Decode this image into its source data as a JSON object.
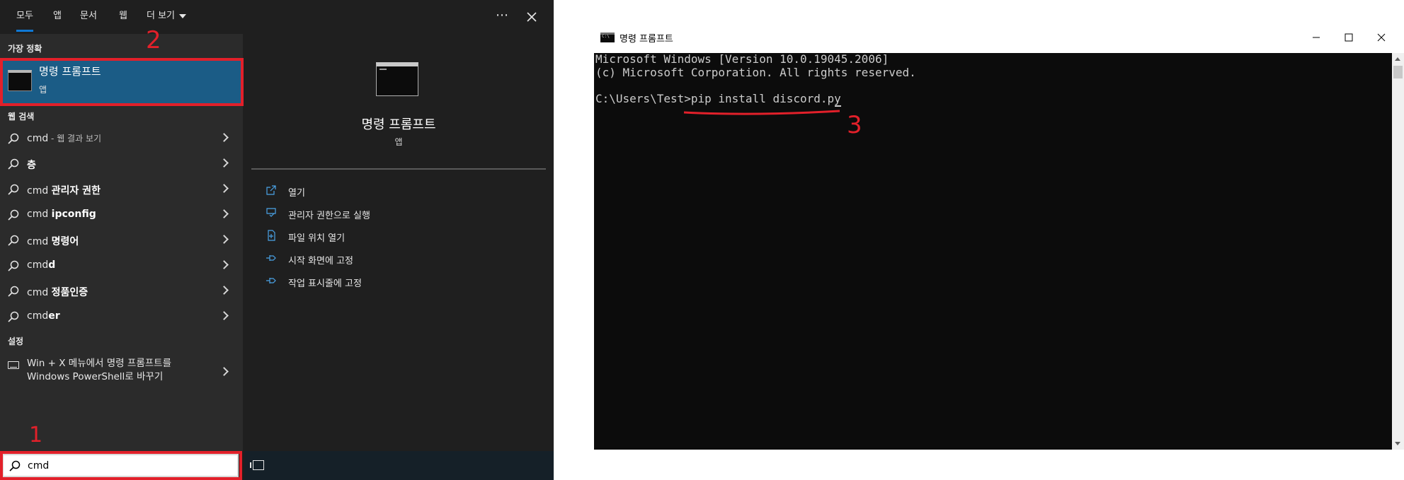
{
  "search_panel": {
    "tabs": [
      {
        "label": "모두",
        "active": true
      },
      {
        "label": "앱",
        "active": false
      },
      {
        "label": "문서",
        "active": false
      },
      {
        "label": "웹",
        "active": false
      },
      {
        "label": "더 보기",
        "active": false
      }
    ],
    "more_icon": "ellipsis-icon",
    "close_icon": "close-icon",
    "best_match": {
      "heading": "가장 정확",
      "name": "명령 프롬프트",
      "type": "앱"
    },
    "web_search": {
      "heading": "웹 검색",
      "items": [
        {
          "prefix": "cmd",
          "bold": "",
          "muted": " - 웹 결과 보기"
        },
        {
          "prefix": "",
          "bold": "층",
          "muted": ""
        },
        {
          "prefix": "cmd ",
          "bold": "관리자 권한",
          "muted": ""
        },
        {
          "prefix": "cmd ",
          "bold": "ipconfig",
          "muted": ""
        },
        {
          "prefix": "cmd ",
          "bold": "명령어",
          "muted": ""
        },
        {
          "prefix": "cmd",
          "bold": "d",
          "muted": ""
        },
        {
          "prefix": "cmd ",
          "bold": "정품인증",
          "muted": ""
        },
        {
          "prefix": "cmd",
          "bold": "er",
          "muted": ""
        }
      ]
    },
    "settings": {
      "heading": "설정",
      "line1": "Win + X 메뉴에서 명령 프롬프트를",
      "line2": "Windows PowerShell로 바꾸기"
    },
    "preview": {
      "title": "명령 프롬프트",
      "subtitle": "앱",
      "actions": [
        {
          "label": "열기",
          "icon": "open-icon"
        },
        {
          "label": "관리자 권한으로 실행",
          "icon": "shield-icon"
        },
        {
          "label": "파일 위치 열기",
          "icon": "file-location-icon"
        },
        {
          "label": "시작 화면에 고정",
          "icon": "pin-icon"
        },
        {
          "label": "작업 표시줄에 고정",
          "icon": "pin-icon"
        }
      ]
    },
    "search_box": {
      "value": "cmd"
    }
  },
  "annotations": {
    "step1": "1",
    "step2": "2",
    "step3": "3",
    "color": "#e2202a"
  },
  "cmd_window": {
    "title": "명령 프롬프트",
    "console_lines": [
      "Microsoft Windows [Version 10.0.19045.2006]",
      "(c) Microsoft Corporation. All rights reserved.",
      "",
      "C:\\Users\\Test>pip install discord.py"
    ],
    "controls": {
      "minimize": "—",
      "maximize": "☐",
      "close": "✕"
    },
    "background": "#0c0c0c",
    "text_color": "#cccccc"
  }
}
